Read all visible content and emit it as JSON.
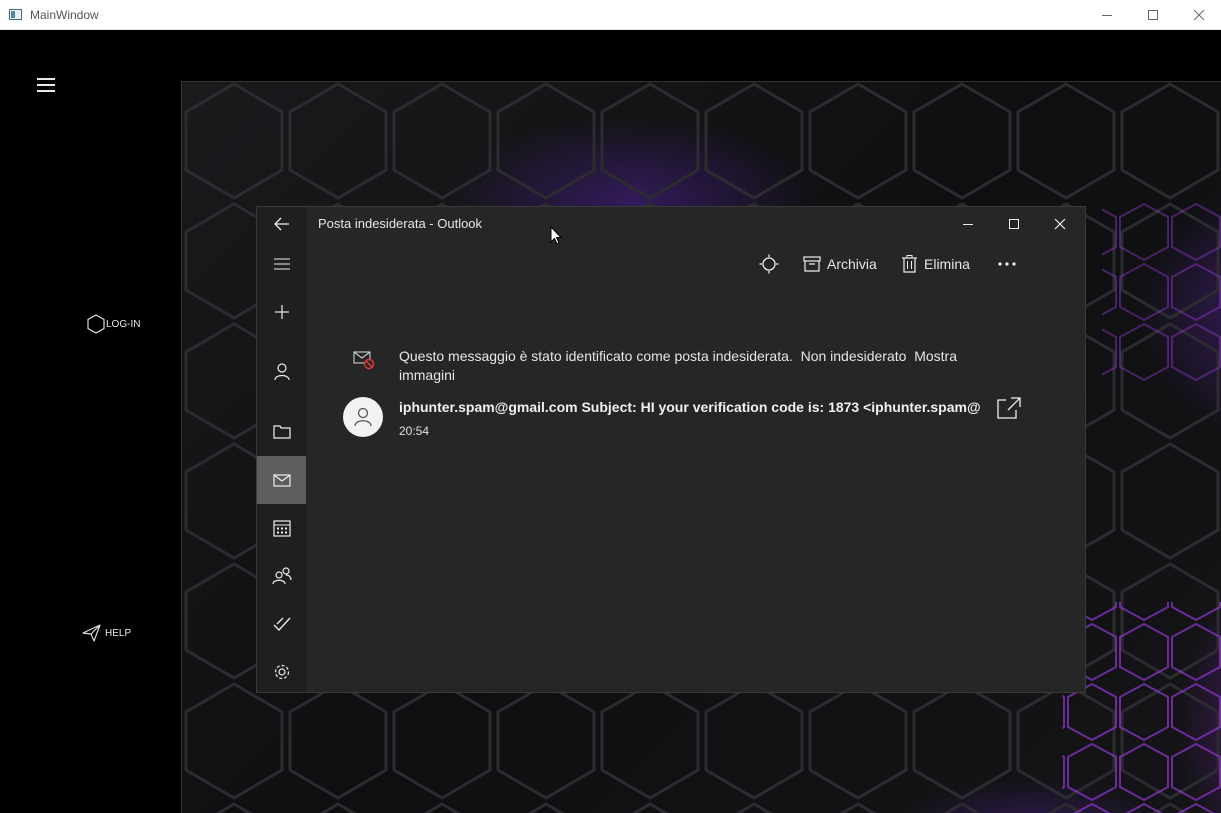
{
  "host_window": {
    "title": "MainWindow",
    "sidebar": {
      "login_label": "LOG-IN",
      "help_label": "HELP"
    }
  },
  "outlook": {
    "title": "Posta indesiderata - Outlook",
    "toolbar": {
      "archive_label": "Archivia",
      "delete_label": "Elimina"
    },
    "junk_banner": {
      "message": "Questo messaggio è stato identificato come posta indesiderata.",
      "not_junk_link": "Non indesiderato",
      "show_images_link": "Mostra immagini"
    },
    "email": {
      "header": "iphunter.spam@gmail.com Subject: HI your verification code is: 1873 <iphunter.spam@",
      "time": "20:54"
    },
    "rail_icons": [
      "back-icon",
      "menu-icon",
      "new-mail-icon",
      "account-icon",
      "folder-icon",
      "mail-icon",
      "calendar-icon",
      "people-icon",
      "todo-icon",
      "settings-icon"
    ]
  },
  "colors": {
    "outlook_bg": "#262626",
    "rail_bg": "#1f1f1f",
    "rail_active": "#5e5e5e",
    "accent_purple": "#8c32ff"
  }
}
